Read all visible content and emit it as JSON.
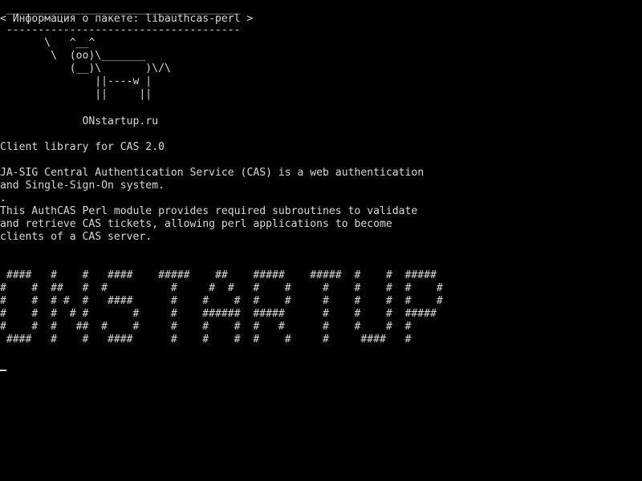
{
  "terminal": {
    "colors": {
      "background": "#000000",
      "foreground": "#d8d8d8"
    },
    "cowsay": {
      "top_border": " _____________________________________",
      "message": "< Информация о пакете: libauthcas-perl >",
      "bottom_border": " -------------------------------------",
      "cow": [
        "       \\   ^__^",
        "        \\  (oo)\\_______",
        "           (__)\\       )\\/\\",
        "               ||----w |",
        "               ||     ||"
      ],
      "site": "             ONstartup.ru"
    },
    "summary": "Client library for CAS 2.0",
    "description": [
      "JA-SIG Central Authentication Service (CAS) is a web authentication",
      "and Single-Sign-On system.",
      ".",
      "This AuthCAS Perl module provides required subroutines to validate",
      "and retrieve CAS tickets, allowing perl applications to become",
      "clients of a CAS server."
    ],
    "banner": [
      " ####   #    #   ####    #####    ##    #####    #####  #    #  #####",
      "#    #  ##   #  #          #     #  #   #    #     #    #    #  #    #",
      "#    #  # #  #   ####      #    #    #  #    #     #    #    #  #    #",
      "#    #  #  # #       #     #    ######  #####      #    #    #  #####",
      "#    #  #   ##  #    #     #    #    #  #   #      #    #    #  #",
      " ####   #    #   ####      #    #    #  #    #     #     ####   #"
    ]
  }
}
